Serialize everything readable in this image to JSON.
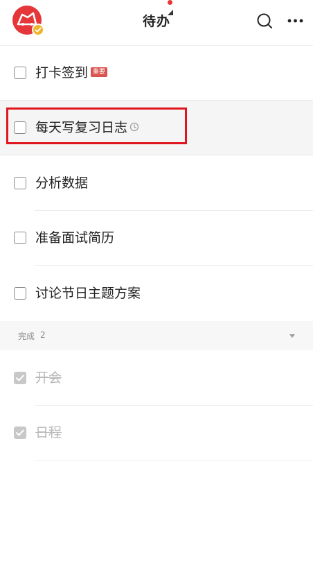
{
  "header": {
    "title": "待办"
  },
  "tasks": [
    {
      "label": "打卡签到",
      "tag": "重要"
    },
    {
      "label": "每天写复习日志"
    },
    {
      "label": "分析数据"
    },
    {
      "label": "准备面试简历"
    },
    {
      "label": "讨论节日主题方案"
    }
  ],
  "completed": {
    "label": "完成",
    "count": "2",
    "items": [
      {
        "label": "开会"
      },
      {
        "label": "日程"
      }
    ]
  },
  "colors": {
    "accent": "#e5363a",
    "badge": "#f0b52d",
    "tag_bg": "#d9534f",
    "highlight_frame": "#e0161e"
  },
  "icons": {
    "avatar": "avatar-logo-icon",
    "verified": "verified-check-icon",
    "search": "search-icon",
    "more": "more-dots-icon",
    "reminder": "clock-icon",
    "expand": "caret-down-icon",
    "done": "checkmark-icon"
  }
}
